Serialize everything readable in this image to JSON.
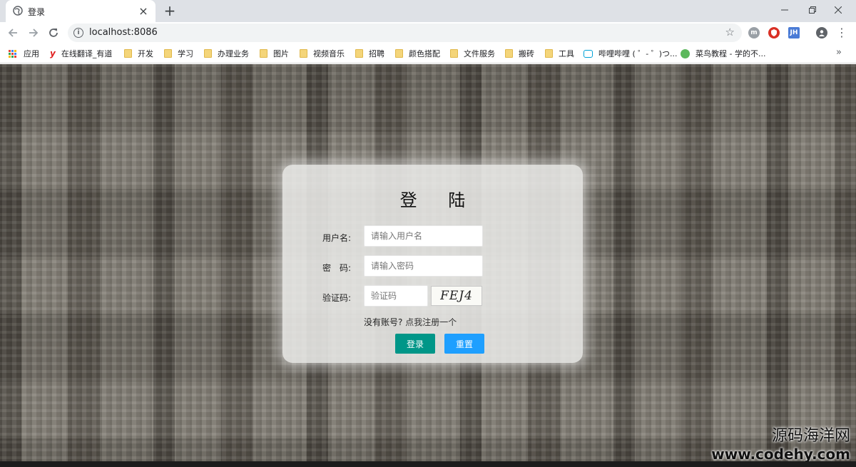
{
  "browser": {
    "tab": {
      "title": "登录",
      "favicon": "globe-icon",
      "close_icon": "close-icon"
    },
    "new_tab_icon": "plus-icon",
    "window_controls": [
      "minimize-icon",
      "restore-icon",
      "close-icon"
    ],
    "toolbar": {
      "back_icon": "arrow-left-icon",
      "forward_icon": "arrow-right-icon",
      "reload_icon": "reload-icon",
      "url": "localhost:8086",
      "bookmark_star_icon": "star-icon"
    },
    "extensions": [
      {
        "name": "m-extension-icon",
        "label": "m",
        "color": "#9aa0a6"
      },
      {
        "name": "shield-extension-icon",
        "label": "",
        "color": "#d93025"
      },
      {
        "name": "jh-extension-icon",
        "label": "JH",
        "color": "#4a7bd6"
      }
    ],
    "bookmarks": [
      {
        "label": "应用",
        "icon": "apps-grid-icon"
      },
      {
        "label": "在线翻译_有道",
        "icon": "youdao-icon"
      },
      {
        "label": "开发",
        "icon": "folder-icon"
      },
      {
        "label": "学习",
        "icon": "folder-icon"
      },
      {
        "label": "办理业务",
        "icon": "folder-icon"
      },
      {
        "label": "图片",
        "icon": "folder-icon"
      },
      {
        "label": "视频音乐",
        "icon": "folder-icon"
      },
      {
        "label": "招聘",
        "icon": "folder-icon"
      },
      {
        "label": "颜色搭配",
        "icon": "folder-icon"
      },
      {
        "label": "文件服务",
        "icon": "folder-icon"
      },
      {
        "label": "搬砖",
        "icon": "folder-icon"
      },
      {
        "label": "工具",
        "icon": "folder-icon"
      },
      {
        "label": "哔哩哔哩 ( ゜- ゜)つ...",
        "icon": "bilibili-icon"
      },
      {
        "label": "菜鸟教程 - 学的不...",
        "icon": "runoob-icon"
      }
    ]
  },
  "login": {
    "title": "登 陆",
    "username": {
      "label": "用户名:",
      "placeholder": "请输入用户名",
      "value": ""
    },
    "password": {
      "label": "密　码:",
      "placeholder": "请输入密码",
      "value": ""
    },
    "captcha": {
      "label": "验证码:",
      "placeholder": "验证码",
      "value": "",
      "code": "FEJ4"
    },
    "register_prompt": "没有账号?",
    "register_link": "点我注册一个",
    "login_button": "登录",
    "reset_button": "重置"
  },
  "watermark": {
    "line1": "源码海洋网",
    "line2": "www.codehy.com"
  }
}
